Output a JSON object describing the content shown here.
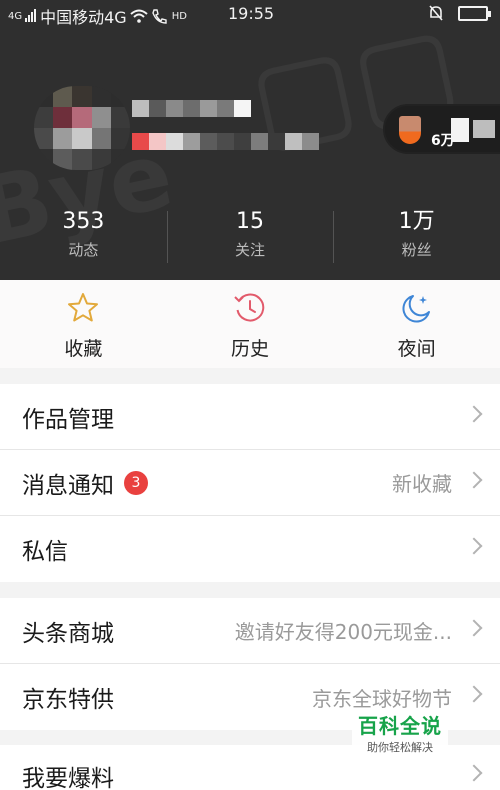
{
  "status_bar": {
    "carrier": "中国移动4G",
    "signal_prefix": "4G",
    "network_badge": "HD",
    "time": "19:55",
    "icons": [
      "signal-icon",
      "wifi-icon",
      "hd-call-icon",
      "silent-icon",
      "battery-icon"
    ]
  },
  "profile": {
    "follow_count_text": "6万"
  },
  "stats": [
    {
      "value": "353",
      "label": "动态"
    },
    {
      "value": "15",
      "label": "关注"
    },
    {
      "value": "1万",
      "label": "粉丝"
    }
  ],
  "quick_actions": [
    {
      "label": "收藏",
      "icon": "star-icon",
      "color": "#e2a93b"
    },
    {
      "label": "历史",
      "icon": "history-icon",
      "color": "#e25a6b"
    },
    {
      "label": "夜间",
      "icon": "night-moon-icon",
      "color": "#3f86d6"
    }
  ],
  "menu_groups": [
    [
      {
        "label": "作品管理",
        "value": ""
      },
      {
        "label": "消息通知",
        "badge": "3",
        "value": "新收藏"
      },
      {
        "label": "私信",
        "value": ""
      }
    ],
    [
      {
        "label": "头条商城",
        "value": "邀请好友得200元现金..."
      },
      {
        "label": "京东特供",
        "value": "京东全球好物节"
      }
    ],
    [
      {
        "label": "我要爆料",
        "value": ""
      }
    ]
  ],
  "watermark": {
    "title": "百科全说",
    "subtitle": "助你轻松解决"
  },
  "colors": {
    "header_bg": "#2f2f2f",
    "badge": "#e9413f",
    "accent_green": "#17a34a"
  }
}
